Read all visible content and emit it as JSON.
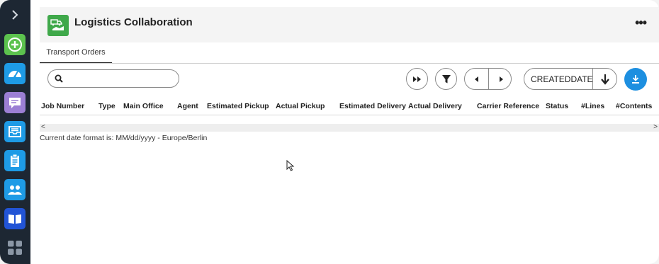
{
  "sidebar": {
    "items": [
      {
        "name": "expand-icon",
        "color": "#1d2733"
      },
      {
        "name": "add-icon",
        "color": "#5cc24e"
      },
      {
        "name": "dashboard-icon",
        "color": "#1e9be6"
      },
      {
        "name": "chat-icon",
        "color": "#9b7fd4"
      },
      {
        "name": "inbox-icon",
        "color": "#1e9be6"
      },
      {
        "name": "clipboard-icon",
        "color": "#1e9be6"
      },
      {
        "name": "users-icon",
        "color": "#1e9be6"
      },
      {
        "name": "book-icon",
        "color": "#2254d6"
      },
      {
        "name": "apps-grid-icon",
        "color": "#8b97a6"
      }
    ]
  },
  "header": {
    "title": "Logistics Collaboration",
    "more_label": "•••",
    "logo_color": "#3fa84a"
  },
  "tabs": [
    {
      "label": "Transport Orders",
      "active": true
    }
  ],
  "toolbar": {
    "search_placeholder": "",
    "sort_field": "CREATEDDATE",
    "download_color": "#1d8fe0"
  },
  "table": {
    "columns": [
      "Job Number",
      "Type",
      "Main Office",
      "Agent",
      "Estimated Pickup",
      "Actual Pickup",
      "Estimated Delivery",
      "Actual Delivery",
      "Carrier Reference",
      "Status",
      "#Lines",
      "#Contents"
    ],
    "rows": []
  },
  "scroll": {
    "left": "<",
    "right": ">"
  },
  "date_format_note": "Current date format is: MM/dd/yyyy - Europe/Berlin"
}
